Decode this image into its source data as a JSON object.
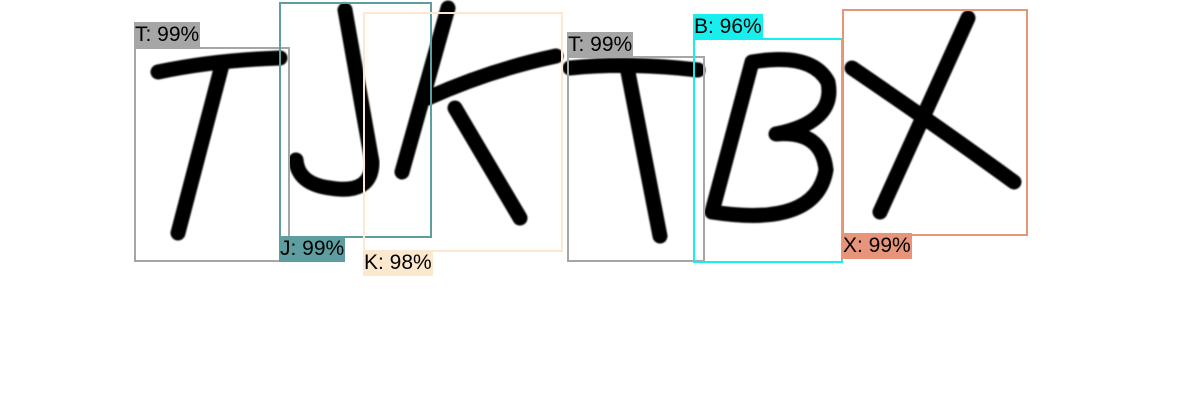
{
  "detections": [
    {
      "label": "T: 99%",
      "color": "#a6a6a6"
    },
    {
      "label": "J: 99%",
      "color": "#5f9ea0"
    },
    {
      "label": "K: 98%",
      "color": "#fbe8cf"
    },
    {
      "label": "T: 99%",
      "color": "#a6a6a6"
    },
    {
      "label": "B: 96%",
      "color": "#19eeee"
    },
    {
      "label": "X: 99%",
      "color": "#e7957a"
    }
  ]
}
